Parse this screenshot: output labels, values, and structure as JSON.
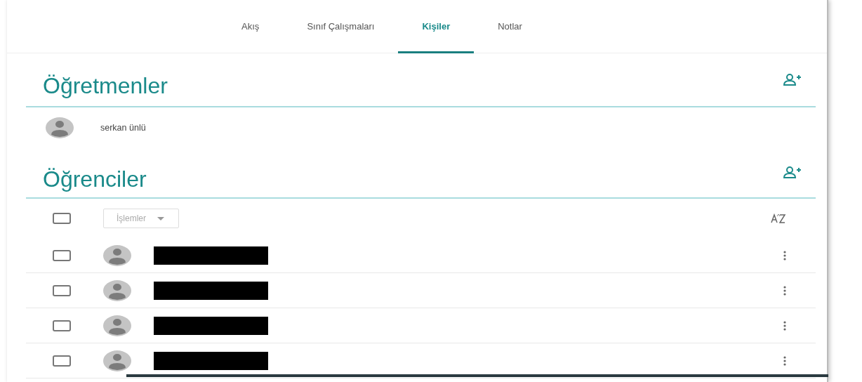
{
  "tabs": [
    {
      "label": "Akış",
      "selected": false
    },
    {
      "label": "Sınıf Çalışmaları",
      "selected": false
    },
    {
      "label": "Kişiler",
      "selected": true
    },
    {
      "label": "Notlar",
      "selected": false
    }
  ],
  "teachers": {
    "title": "Öğretmenler",
    "people": [
      {
        "name": "serkan ünlü"
      }
    ]
  },
  "students": {
    "title": "Öğrenciler",
    "select_all": {
      "checked": false
    },
    "actions": {
      "label": "İşlemler"
    },
    "rows": [
      {
        "checked": false,
        "kind": "redacted"
      },
      {
        "checked": false,
        "kind": "redacted"
      },
      {
        "checked": false,
        "kind": "redacted"
      },
      {
        "checked": false,
        "kind": "redacted"
      }
    ]
  }
}
